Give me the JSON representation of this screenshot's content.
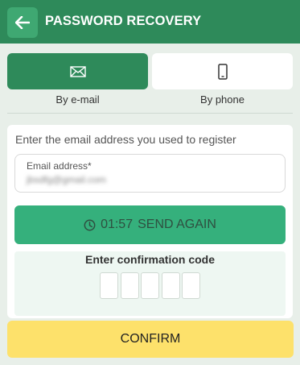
{
  "header": {
    "title": "PASSWORD RECOVERY",
    "back_icon": "arrow-left-icon"
  },
  "tabs": [
    {
      "label": "By e-mail",
      "icon": "envelope-icon",
      "active": true
    },
    {
      "label": "By phone",
      "icon": "phone-icon",
      "active": false
    }
  ],
  "form": {
    "instruction": "Enter the email address you used to register",
    "email_label": "Email address*",
    "email_value": "jbsdfg@gmail.com"
  },
  "send_again": {
    "timer": "01:57",
    "label": "SEND AGAIN",
    "icon": "clock-icon"
  },
  "confirmation": {
    "title": "Enter confirmation code",
    "digits": 5
  },
  "confirm_button": {
    "label": "CONFIRM"
  },
  "colors": {
    "header_bg": "#2e8a5a",
    "accent_green": "#35b07c",
    "confirm_yellow": "#fde16b",
    "page_bg": "#e8efe9"
  }
}
